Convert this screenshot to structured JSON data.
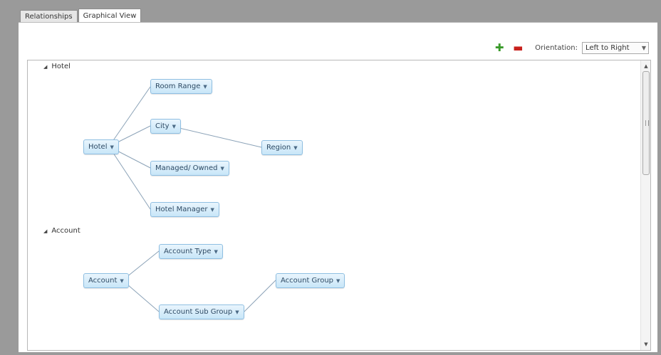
{
  "tabs": [
    {
      "label": "Relationships",
      "active": false
    },
    {
      "label": "Graphical View",
      "active": true
    }
  ],
  "toolbar": {
    "expand_icon": "plus-icon",
    "collapse_icon": "minus-icon",
    "orientation_label": "Orientation:",
    "orientation_value": "Left to Right"
  },
  "groups": {
    "hotel": {
      "header": "Hotel",
      "nodes": {
        "root": "Hotel",
        "room_range": "Room Range",
        "city": "City",
        "managed_owned": "Managed/ Owned",
        "hotel_manager": "Hotel Manager",
        "region": "Region"
      }
    },
    "account": {
      "header": "Account",
      "nodes": {
        "root": "Account",
        "account_type": "Account Type",
        "account_sub_group": "Account Sub Group",
        "account_group": "Account Group"
      }
    }
  },
  "colors": {
    "node_fill": "#d7eefb",
    "node_border": "#8fbfe2",
    "edge": "#8ca3b8",
    "expand_icon": "#3a9a2a",
    "collapse_icon": "#c8201c"
  }
}
